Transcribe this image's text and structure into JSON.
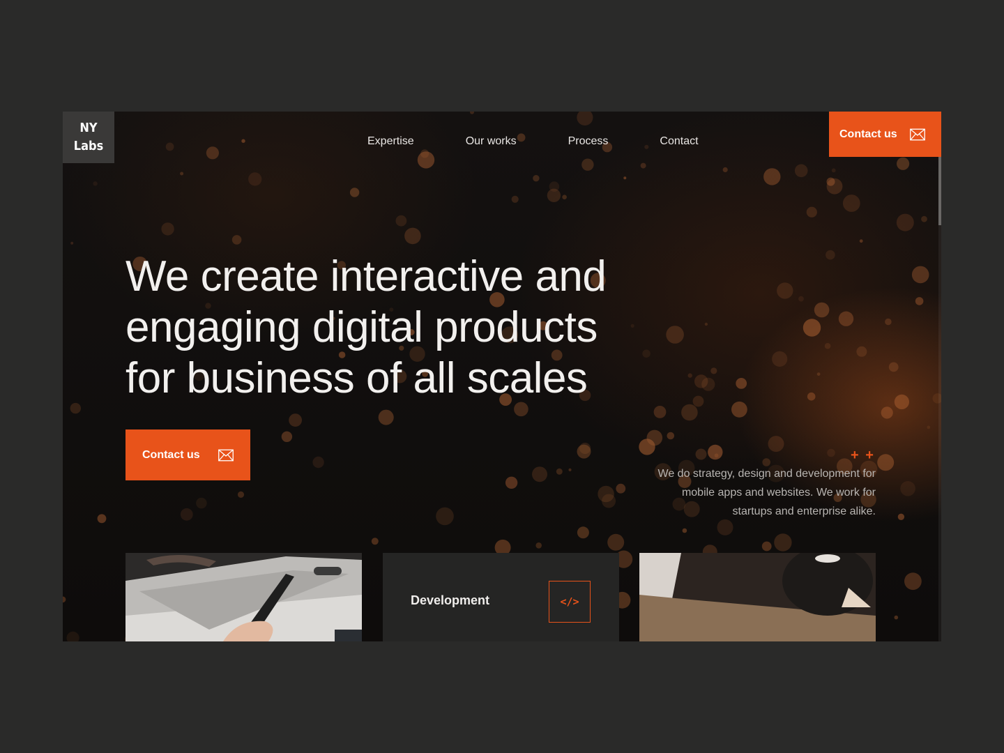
{
  "brand": {
    "logo_line1": "NY",
    "logo_line2": "Labs"
  },
  "nav": {
    "items": [
      {
        "label": "Expertise"
      },
      {
        "label": "Our works"
      },
      {
        "label": "Process"
      },
      {
        "label": "Contact"
      }
    ]
  },
  "header": {
    "cta_label": "Contact us"
  },
  "hero": {
    "title_line1": "We create interactive and",
    "title_line2": "engaging digital products",
    "title_line3": "for business of all scales",
    "cta_label": "Contact us",
    "plus_marks": "+ +",
    "tagline_line1": "We do strategy, design and development for",
    "tagline_line2": "mobile apps and websites. We work for",
    "tagline_line3": "startups and enterprise alike."
  },
  "cards": {
    "development_label": "Development",
    "development_icon": "</>"
  },
  "colors": {
    "accent": "#e8531a",
    "page_bg": "#2a2a29",
    "hero_bg": "#0f0d0c",
    "card_dark": "#252524"
  },
  "icons": {
    "mail": "envelope-icon",
    "code": "code-icon"
  }
}
